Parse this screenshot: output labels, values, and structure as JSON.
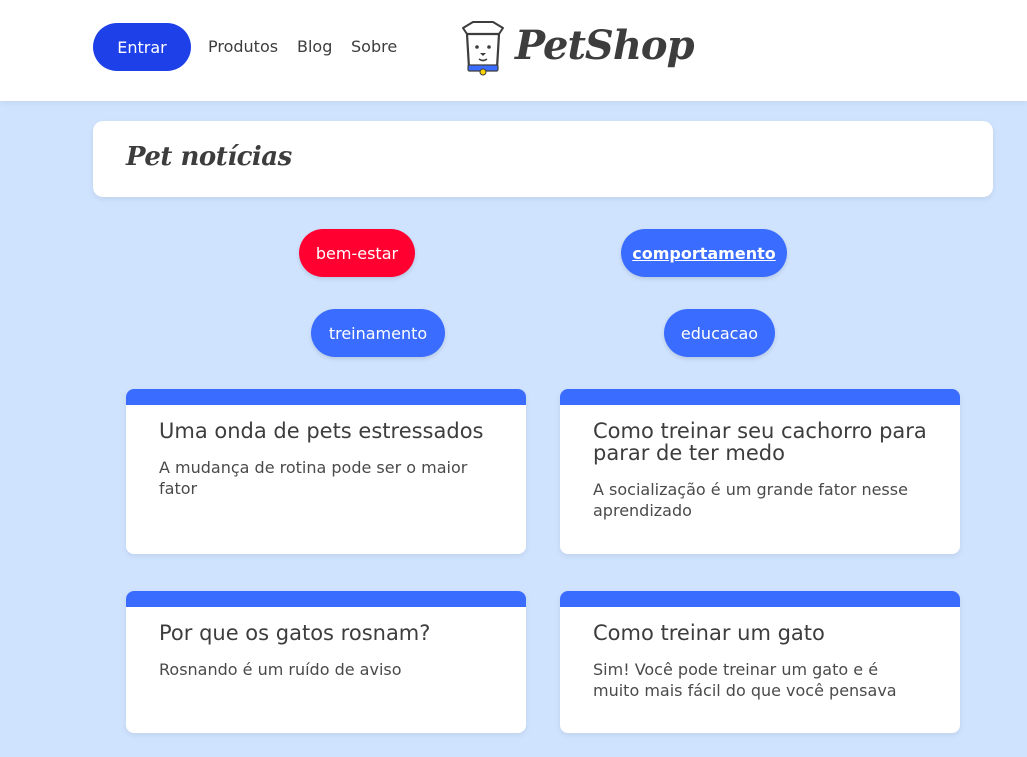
{
  "header": {
    "login_label": "Entrar",
    "nav": [
      "Produtos",
      "Blog",
      "Sobre"
    ],
    "logo_text": "PetShop"
  },
  "page_title": "Pet notícias",
  "tags": [
    {
      "label": "bem-estar",
      "color": "#ff0030"
    },
    {
      "label": "comportamento",
      "color": "#3a6cff",
      "active": true
    },
    {
      "label": "treinamento",
      "color": "#3a6cff"
    },
    {
      "label": "educacao",
      "color": "#3a6cff"
    }
  ],
  "articles": [
    {
      "title": "Uma onda de pets estressados",
      "summary": "A mudança de rotina pode ser o maior fator"
    },
    {
      "title": "Como treinar seu cachorro para parar de ter medo",
      "summary": "A socialização é um grande fator nesse aprendizado"
    },
    {
      "title": "Por que os gatos rosnam?",
      "summary": "Rosnando é um ruído de aviso"
    },
    {
      "title": "Como treinar um gato",
      "summary": "Sim! Você pode treinar um gato e é muito mais fácil do que você pensava"
    }
  ],
  "colors": {
    "background": "#cfe3ff",
    "primary_button": "#1d40e8",
    "tag_blue": "#3a6cff",
    "tag_red": "#ff0030"
  }
}
